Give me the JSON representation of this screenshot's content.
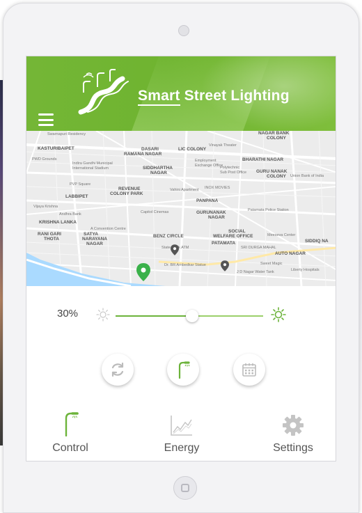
{
  "app": {
    "title_part1": "Smart",
    "title_part2": " Street Lighting"
  },
  "map": {
    "labels": [
      {
        "t": "Swarnapuri Residency",
        "cls": "small"
      },
      {
        "t": "KASTURIBAIPET"
      },
      {
        "t": "DASARI"
      },
      {
        "t": "RAMANA NAGAR"
      },
      {
        "t": "LIC COLONY"
      },
      {
        "t": "Vinayak Theater"
      },
      {
        "t": "NAGAR BANK"
      },
      {
        "t": "COLONY"
      },
      {
        "t": "BHARATHI NAGAR"
      },
      {
        "t": "PWD Grounds",
        "cls": "small"
      },
      {
        "t": "Indira Gandhi Municipal",
        "cls": "small"
      },
      {
        "t": "International Stadium",
        "cls": "small"
      },
      {
        "t": "SIDDHARTHA"
      },
      {
        "t": "NAGAR"
      },
      {
        "t": "Employment",
        "cls": "small"
      },
      {
        "t": "Exchange Office",
        "cls": "small"
      },
      {
        "t": "Polytechnic",
        "cls": "small"
      },
      {
        "t": "Sub Post Office",
        "cls": "small"
      },
      {
        "t": "GURU NANAK"
      },
      {
        "t": "COLONY"
      },
      {
        "t": "Union Bank of India",
        "cls": "small"
      },
      {
        "t": "PVP Square",
        "cls": "small"
      },
      {
        "t": "REVENUE"
      },
      {
        "t": "COLONY PARK"
      },
      {
        "t": "Vahini Apartment",
        "cls": "small"
      },
      {
        "t": "INOX MOVIES",
        "cls": "small"
      },
      {
        "t": "LABBIPET"
      },
      {
        "t": "PANPANA"
      },
      {
        "t": "Vijaya Krishna",
        "cls": "small"
      },
      {
        "t": "Andhra Bank",
        "cls": "small"
      },
      {
        "t": "Capitol Cinemas",
        "cls": "small"
      },
      {
        "t": "GURUNANAK"
      },
      {
        "t": "NAGAR"
      },
      {
        "t": "Patamata Police Station",
        "cls": "small"
      },
      {
        "t": "KRISHNA LANKA"
      },
      {
        "t": "A Convention Centre",
        "cls": "small"
      },
      {
        "t": "RANI GARI"
      },
      {
        "t": "THOTA"
      },
      {
        "t": "SATYA"
      },
      {
        "t": "NARAYANA"
      },
      {
        "t": "NAGAR"
      },
      {
        "t": "BENZ CIRCLE"
      },
      {
        "t": "SOCIAL"
      },
      {
        "t": "WELFARE OFFICE"
      },
      {
        "t": "Meeseva Center",
        "cls": "small"
      },
      {
        "t": "SIDDIQ NA"
      },
      {
        "t": "PATAMATA"
      },
      {
        "t": "SRI DURGA MAHAL",
        "cls": "small"
      },
      {
        "t": "State Bank ATM",
        "cls": "small"
      },
      {
        "t": "AUTO NAGAR"
      },
      {
        "t": "Sweet Magic",
        "cls": "small"
      },
      {
        "t": "Dr. BR Ambedkar Statue",
        "cls": "small"
      },
      {
        "t": "J D Nagar Water Tank",
        "cls": "small"
      },
      {
        "t": "Liberty Hospitals",
        "cls": "small"
      }
    ]
  },
  "slider": {
    "value_label": "30%",
    "value": 0.52
  },
  "actions": [
    {
      "name": "refresh-icon"
    },
    {
      "name": "street-lamp-icon"
    },
    {
      "name": "calendar-icon"
    }
  ],
  "tabs": [
    {
      "label": "Control",
      "icon": "street-lamp-icon",
      "color": "#6cb33a"
    },
    {
      "label": "Energy",
      "icon": "line-chart-icon",
      "color": "#bbbbbb"
    },
    {
      "label": "Settings",
      "icon": "gear-icon",
      "color": "#bbbbbb"
    }
  ],
  "colors": {
    "accent": "#6cb33a",
    "header_green": "#74b636",
    "pin_active": "#3ab14a",
    "pin_inactive": "#555555"
  }
}
